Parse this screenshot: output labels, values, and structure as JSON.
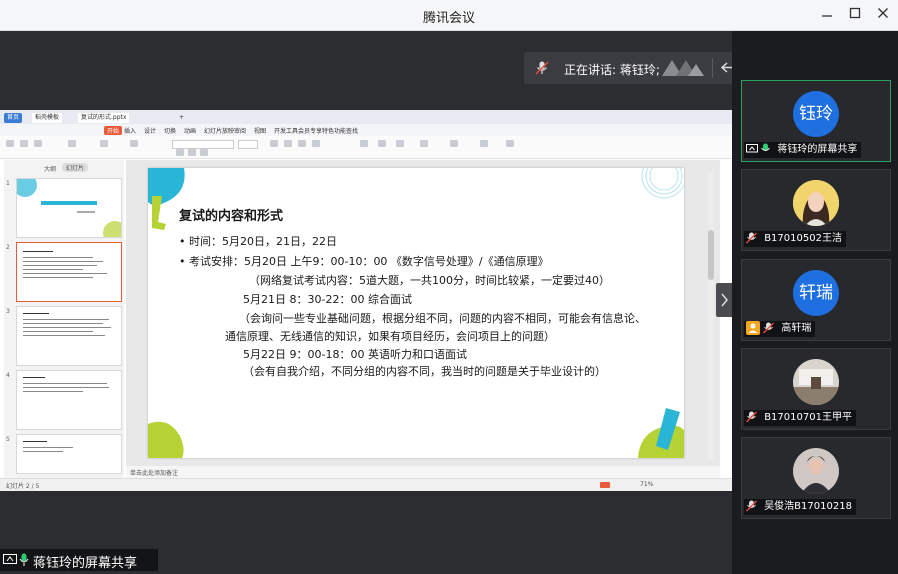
{
  "window": {
    "title": "腾讯会议"
  },
  "speaking": {
    "label": "正在讲话: 蒋钰玲;"
  },
  "share_label": "蒋钰玲的屏幕共享",
  "wps": {
    "tabs": [
      "首页",
      "稻壳模板",
      "复试的形式.pptx",
      "+"
    ],
    "menu": [
      "开始",
      "插入",
      "设计",
      "切换",
      "动画",
      "幻灯片放映",
      "审阅",
      "视图",
      "开发工具",
      "会员专享",
      "特色功能",
      "查找"
    ],
    "thumb_header": "大纲",
    "thumb_tab": "幻灯片",
    "thumb_numbers": [
      "1",
      "2",
      "3",
      "4",
      "5"
    ],
    "notes": "单击此处添加备注",
    "status_left": "幻灯片 2 / 5",
    "status_zoom": "71%"
  },
  "slide": {
    "title": "复试的内容和形式",
    "lines": [
      "• 时间：5月20日，21日，22日",
      "• 考试安排：5月20日 上午9：00-10：00 《数字信号处理》/《通信原理》",
      "（网络复试考试内容：5道大题，一共100分，时间比较紧，一定要过40）",
      "5月21日 8：30-22：00 综合面试",
      "（会询问一些专业基础问题，根据分组不同，问题的内容不相同，可能会有信息论、",
      "通信原理、无线通信的知识，如果有项目经历，会问项目上的问题）",
      "5月22日 9：00-18：00 英语听力和口语面试",
      "（会有自我介绍，不同分组的内容不同，我当时的问题是关于毕业设计的）"
    ]
  },
  "participants": [
    {
      "name": "蒋钰玲的屏幕共享",
      "avatar_text": "钰玲",
      "avatar_type": "text",
      "active": true
    },
    {
      "name": "B17010502王洁",
      "avatar_type": "photo",
      "active": false
    },
    {
      "name": "高轩瑞",
      "avatar_text": "轩瑞",
      "avatar_type": "text",
      "active": false
    },
    {
      "name": "B17010701王甲平",
      "avatar_type": "photo",
      "active": false
    },
    {
      "name": "吴俊浩B17010218",
      "avatar_type": "photo",
      "active": false
    }
  ],
  "colors": {
    "accent": "#1e6fe0",
    "active_border": "#26a25e",
    "mic_green": "#2ecc71",
    "slide_teal": "#29b6d6",
    "slide_green": "#b5d334"
  }
}
